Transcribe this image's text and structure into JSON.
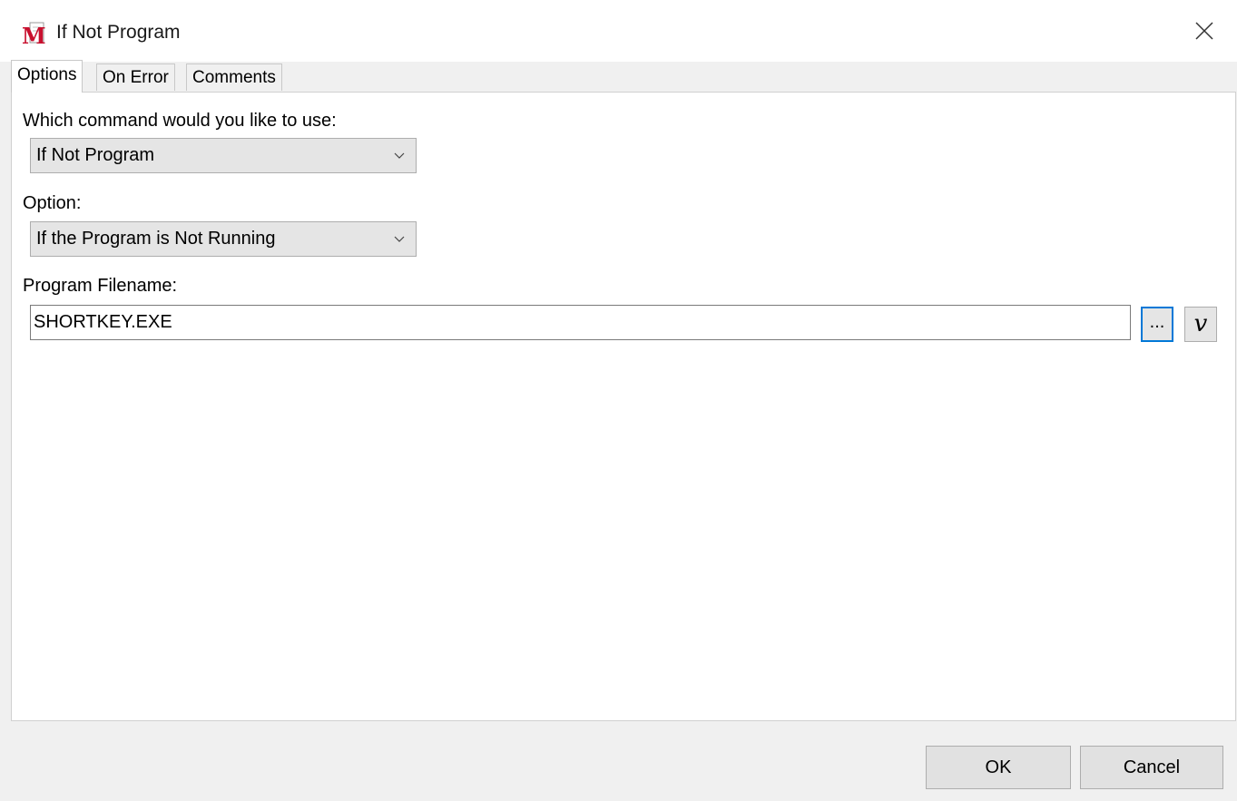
{
  "window": {
    "title": "If Not Program",
    "icon_letter": "M"
  },
  "tabs": [
    {
      "label": "Options",
      "active": true
    },
    {
      "label": "On Error",
      "active": false
    },
    {
      "label": "Comments",
      "active": false
    }
  ],
  "options": {
    "command_label": "Which command would you like to use:",
    "command_value": "If Not Program",
    "option_label": "Option:",
    "option_value": "If the Program is Not Running",
    "filename_label": "Program Filename:",
    "filename_value": "SHORTKEY.EXE",
    "browse_label": "...",
    "variable_label": "v"
  },
  "footer": {
    "ok_label": "OK",
    "cancel_label": "Cancel"
  },
  "colors": {
    "focus_border": "#0078d7",
    "icon_red": "#c8102e",
    "button_face": "#e1e1e1"
  },
  "icons": {
    "app": "macro-m-icon",
    "close": "close-icon",
    "dropdown": "chevron-down-icon"
  }
}
